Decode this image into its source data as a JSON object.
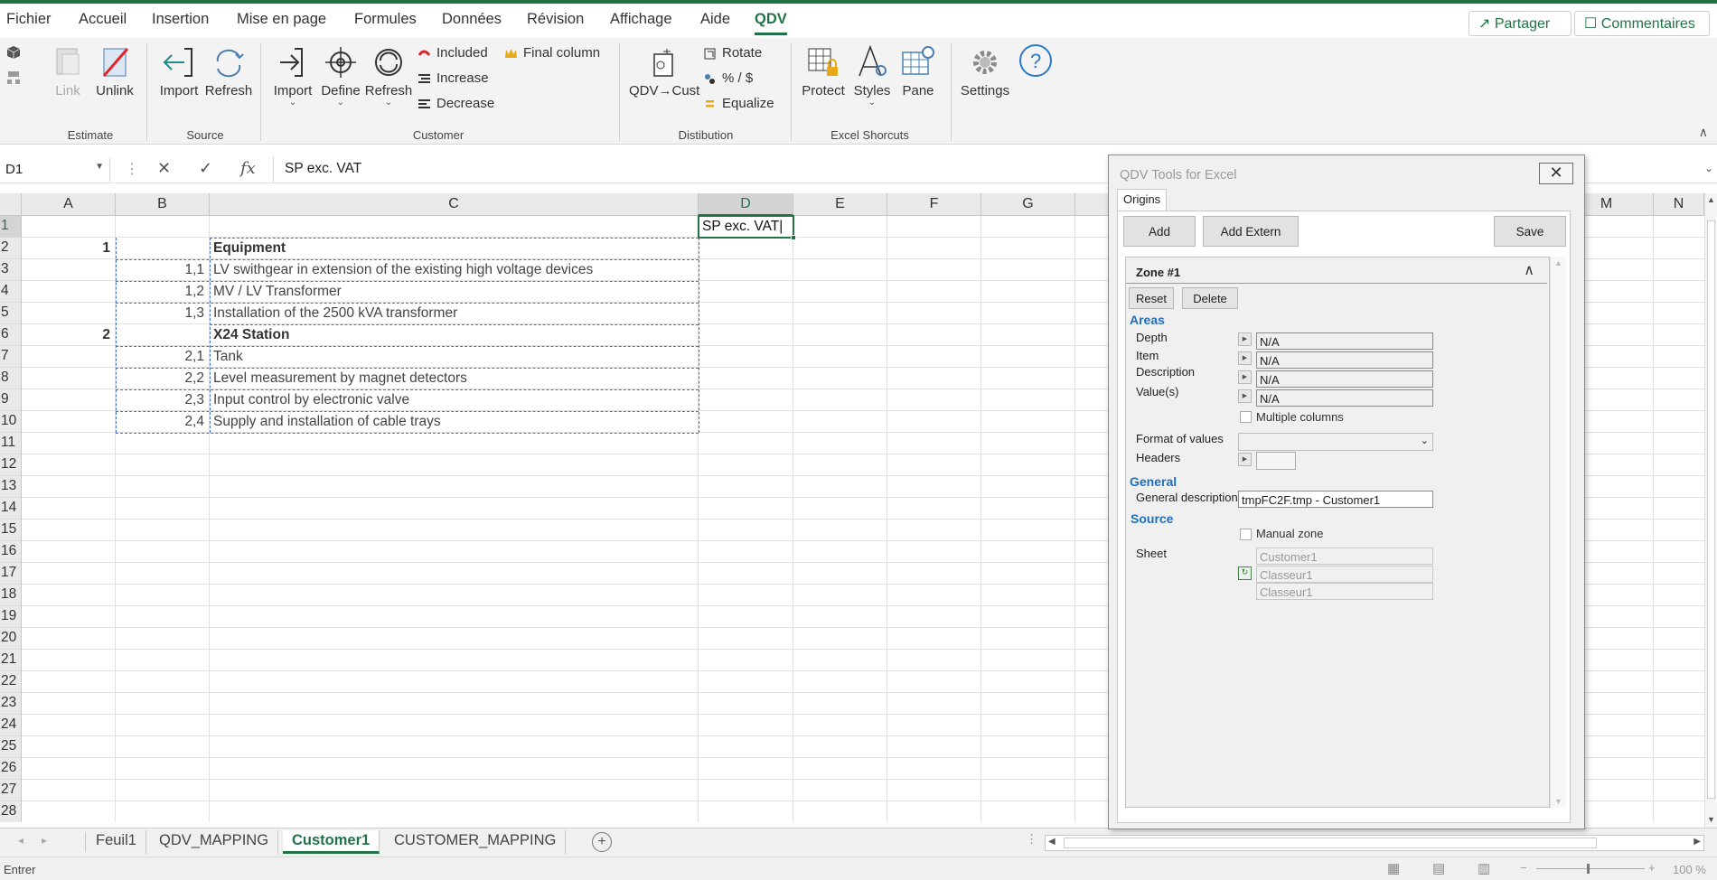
{
  "menu": {
    "tabs": [
      "Fichier",
      "Accueil",
      "Insertion",
      "Mise en page",
      "Formules",
      "Données",
      "Révision",
      "Affichage",
      "Aide",
      "QDV"
    ],
    "share_label": "Partager",
    "comments_label": "Commentaires"
  },
  "ribbon": {
    "estimate": {
      "link": "Link",
      "unlink": "Unlink",
      "label": "Estimate"
    },
    "source": {
      "import": "Import",
      "refresh": "Refresh",
      "label": "Source"
    },
    "customer": {
      "import": "Import",
      "define": "Define",
      "refresh": "Refresh",
      "included": "Included",
      "increase": "Increase",
      "decrease": "Decrease",
      "final_column": "Final column",
      "label": "Customer"
    },
    "distibution": {
      "qdv_cust": "QDV→Cust",
      "rotate": "Rotate",
      "percent": "% / $",
      "equalize": "Equalize",
      "label": "Distibution"
    },
    "shortcuts": {
      "protect": "Protect",
      "styles": "Styles",
      "pane": "Pane",
      "label": "Excel Shorcuts"
    },
    "settings": {
      "settings": "Settings"
    }
  },
  "formula_bar": {
    "name_box": "D1",
    "content": "SP exc. VAT"
  },
  "grid": {
    "columns": [
      "A",
      "B",
      "C",
      "D",
      "E",
      "F",
      "G"
    ],
    "right_columns": [
      "M",
      "N"
    ],
    "rows": [
      "1",
      "2",
      "3",
      "4",
      "5",
      "6",
      "7",
      "8",
      "9",
      "10",
      "11",
      "12",
      "13",
      "14",
      "15",
      "16",
      "17",
      "18",
      "19",
      "20",
      "21",
      "22",
      "23",
      "24",
      "25",
      "26",
      "27",
      "28"
    ],
    "active_cell_value": "SP exc. VAT",
    "data_rows": [
      {
        "a": "1",
        "b": "",
        "c": "Equipment",
        "bold": true
      },
      {
        "a": "",
        "b": "1,1",
        "c": "LV swithgear in extension of the existing high voltage devices",
        "bold": false
      },
      {
        "a": "",
        "b": "1,2",
        "c": "MV / LV Transformer",
        "bold": false
      },
      {
        "a": "",
        "b": "1,3",
        "c": "Installation of the 2500 kVA transformer",
        "bold": false
      },
      {
        "a": "2",
        "b": "",
        "c": "X24 Station",
        "bold": true
      },
      {
        "a": "",
        "b": "2,1",
        "c": "Tank",
        "bold": false
      },
      {
        "a": "",
        "b": "2,2",
        "c": "Level measurement by magnet detectors",
        "bold": false
      },
      {
        "a": "",
        "b": "2,3",
        "c": "Input control by electronic valve",
        "bold": false
      },
      {
        "a": "",
        "b": "2,4",
        "c": "Supply and installation of cable trays",
        "bold": false
      }
    ]
  },
  "sheets": [
    "Feuil1",
    "QDV_MAPPING",
    "Customer1",
    "CUSTOMER_MAPPING"
  ],
  "active_sheet": "Customer1",
  "status": {
    "mode": "Entrer",
    "zoom": "100 %"
  },
  "dialog": {
    "title": "QDV Tools for Excel",
    "tab": "Origins",
    "add": "Add",
    "add_extern": "Add Extern",
    "save": "Save",
    "zone_title": "Zone #1",
    "reset": "Reset",
    "delete": "Delete",
    "areas_title": "Areas",
    "depth_label": "Depth",
    "depth_value": "N/A",
    "item_label": "Item",
    "item_value": "N/A",
    "description_label": "Description",
    "description_value": "N/A",
    "values_label": "Value(s)",
    "values_value": "N/A",
    "multiple_columns": "Multiple columns",
    "format_label": "Format of values",
    "headers_label": "Headers",
    "general_title": "General",
    "general_description_label": "General description",
    "general_description_value": "tmpFC2F.tmp - Customer1",
    "source_title": "Source",
    "manual_zone": "Manual zone",
    "sheet_label": "Sheet",
    "sheet_values": [
      "Customer1",
      "Classeur1",
      "Classeur1"
    ]
  },
  "colors": {
    "accent": "#217346",
    "section_blue": "#1f6fbf",
    "selection_dash": "#4472c4"
  }
}
